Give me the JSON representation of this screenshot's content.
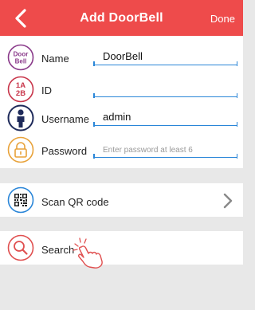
{
  "header": {
    "title": "Add DoorBell",
    "done_label": "Done"
  },
  "form": {
    "name": {
      "label": "Name",
      "value": "DoorBell",
      "icon": "doorbell-icon",
      "icon_text": [
        "Door",
        "Bell"
      ]
    },
    "id": {
      "label": "ID",
      "value": "",
      "icon": "id-icon",
      "icon_text": [
        "1A",
        "2B"
      ]
    },
    "username": {
      "label": "Username",
      "value": "admin",
      "icon": "user-icon"
    },
    "password": {
      "label": "Password",
      "placeholder": "Enter password at least 6",
      "icon": "lock-icon"
    }
  },
  "scan": {
    "label": "Scan QR code",
    "icon": "qr-code-icon"
  },
  "search": {
    "label": "Search",
    "icon": "magnifier-icon"
  },
  "colors": {
    "header": "#ee4b4b",
    "field_underline": "#2a86d8",
    "name_icon": "#8a3a8a",
    "id_icon": "#c8354a",
    "user_icon": "#1e2a5a",
    "lock_icon": "#e8a23a",
    "search_icon": "#e05050"
  }
}
